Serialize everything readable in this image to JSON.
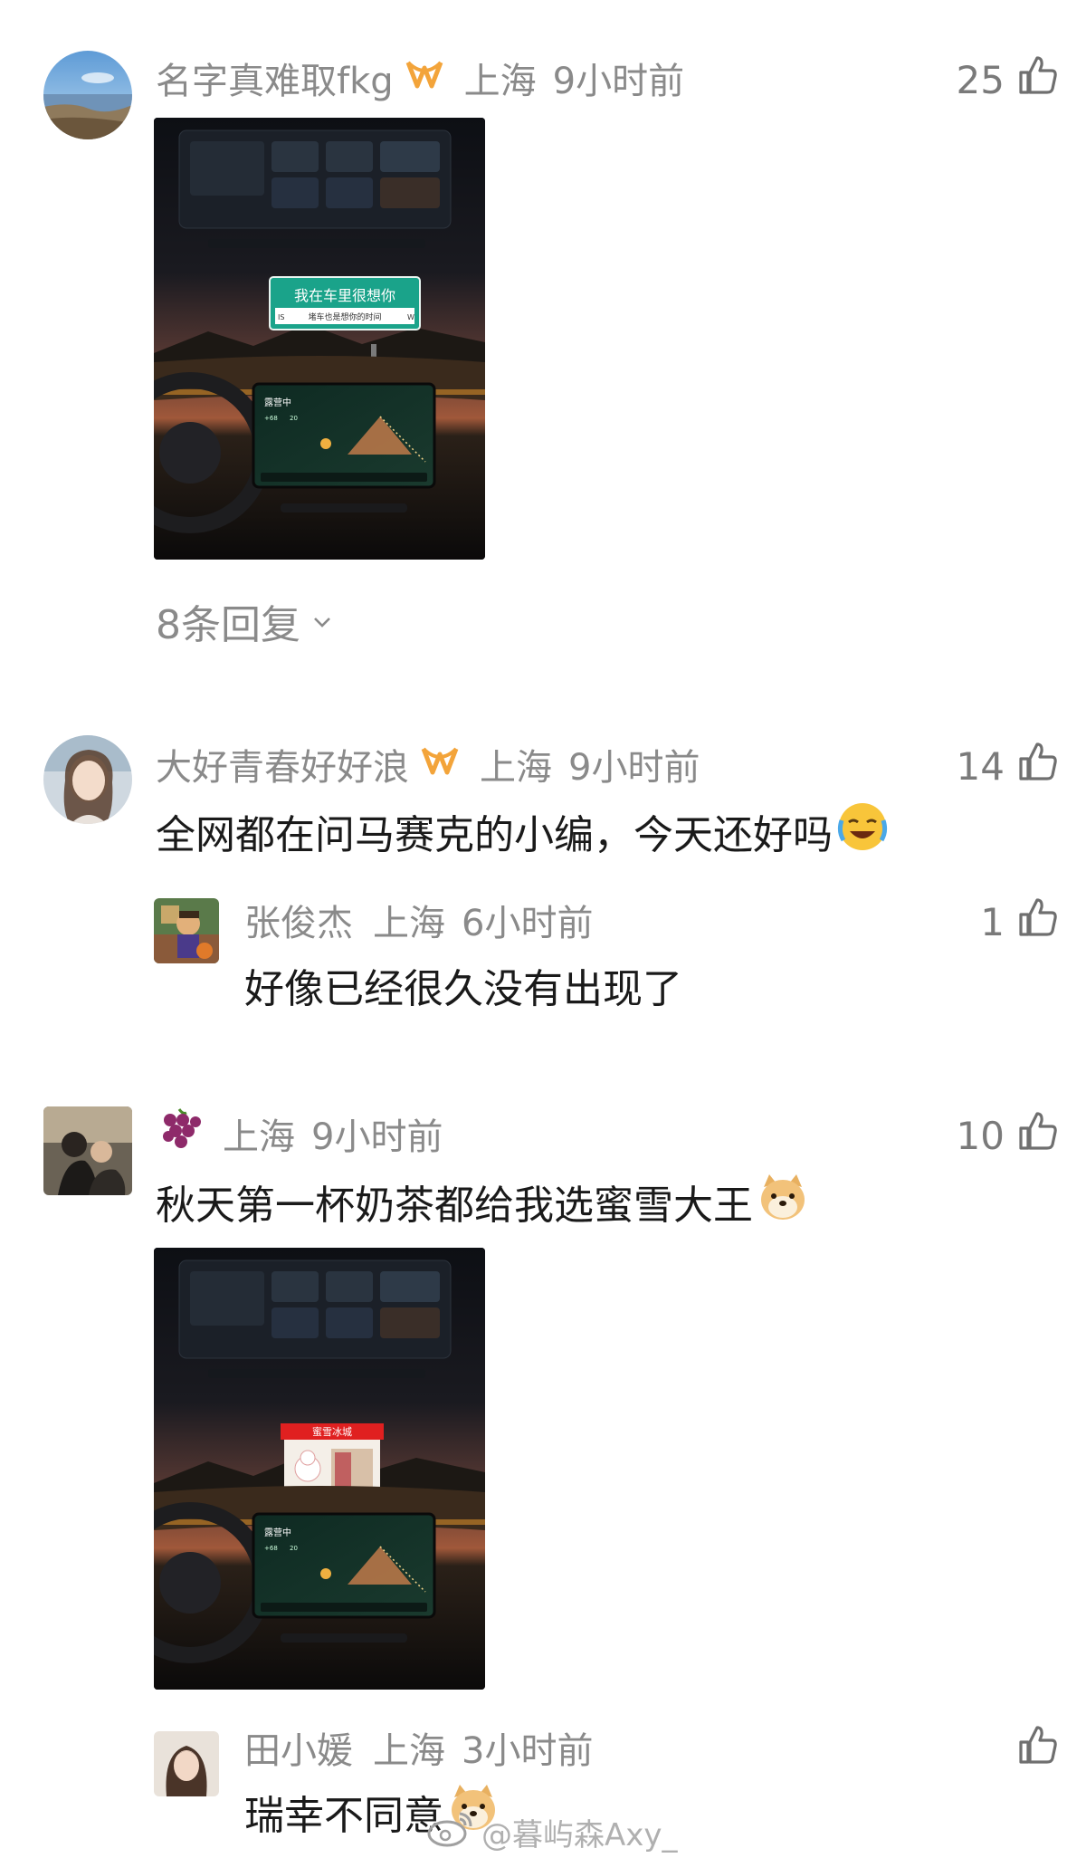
{
  "comments": [
    {
      "username": "名字真难取fkg",
      "location": "上海",
      "time": "9小时前",
      "likes": "25",
      "image_sign": {
        "line1": "我在车里很想你",
        "line2": "堵车也是想你的时间",
        "left": "IS",
        "right": "W"
      },
      "replies_label": "8条回复"
    },
    {
      "username": "大好青春好好浪",
      "location": "上海",
      "time": "9小时前",
      "likes": "14",
      "text": "全网都在问马赛克的小编，今天还好吗",
      "reply": {
        "username": "张俊杰",
        "location": "上海",
        "time": "6小时前",
        "likes": "1",
        "text": "好像已经很久没有出现了"
      }
    },
    {
      "location": "上海",
      "time": "9小时前",
      "likes": "10",
      "text": "秋天第一杯奶茶都给我选蜜雪大王",
      "image_store": {
        "name": "蜜雪冰城"
      },
      "reply": {
        "username": "田小媛",
        "location": "上海",
        "time": "3小时前",
        "text": "瑞幸不同意"
      }
    }
  ],
  "car_screen": {
    "title": "露营中",
    "temp": "+68",
    "value": "20"
  },
  "watermark": "@暮屿森Axy_",
  "colors": {
    "meta": "#8a8a8a",
    "text": "#1a1a1a",
    "badge": "#f3a43a",
    "icon": "#6f6f6f"
  }
}
